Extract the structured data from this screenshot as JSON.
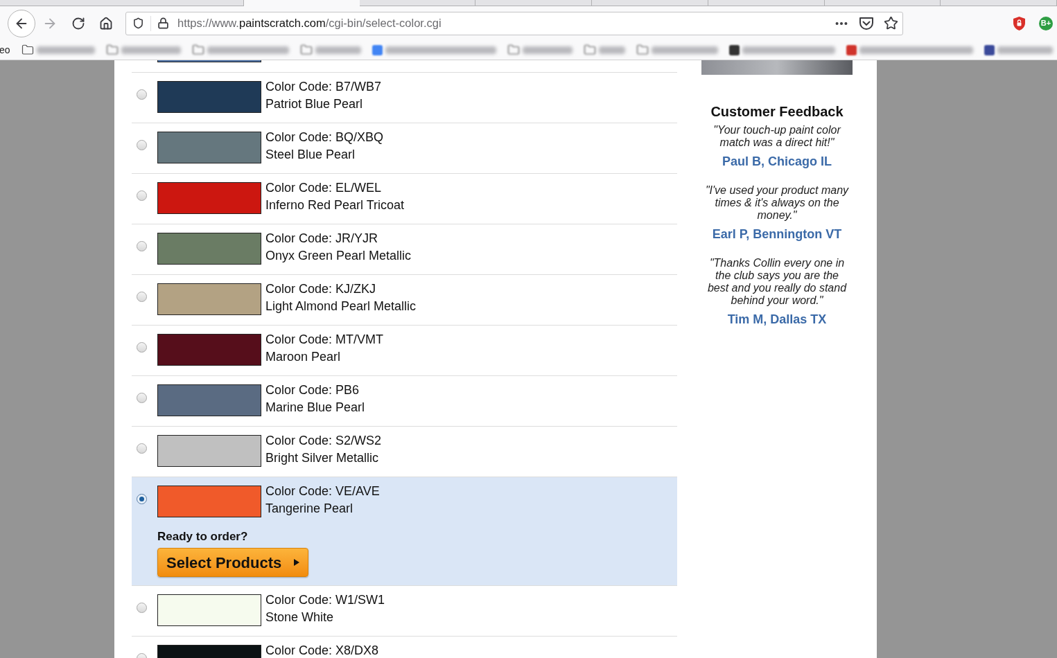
{
  "browser": {
    "tabs": [
      {
        "selected": false
      },
      {
        "selected": true
      },
      {
        "selected": false
      },
      {
        "selected": false
      },
      {
        "selected": false
      },
      {
        "selected": false
      },
      {
        "selected": false
      },
      {
        "selected": false
      }
    ],
    "navigation": {
      "forward_disabled": true
    },
    "address_bar": {
      "url_prefix": "https://www.",
      "url_domain": "paintscratch.com",
      "url_path": "/cgi-bin/select-color.cgi"
    },
    "extension_badge": "B+",
    "bookmarks": {
      "clipped_label": "eo",
      "items": [
        {
          "kind": "folder"
        },
        {
          "kind": "folder"
        },
        {
          "kind": "folder"
        },
        {
          "kind": "folder"
        },
        {
          "kind": "site",
          "color": "#4285f4"
        },
        {
          "kind": "folder"
        },
        {
          "kind": "folder"
        },
        {
          "kind": "folder"
        },
        {
          "kind": "site",
          "color": "#333333"
        },
        {
          "kind": "site",
          "color": "#d0342c"
        },
        {
          "kind": "site",
          "color": "#3b4a9a"
        }
      ]
    }
  },
  "color_list": {
    "clipped_swatch": {
      "color": "#4a6fa5"
    },
    "items": [
      {
        "code": "Color Code: B7/WB7",
        "name": "Patriot Blue Pearl",
        "color": "#1f3a57",
        "selected": false
      },
      {
        "code": "Color Code: BQ/XBQ",
        "name": "Steel Blue Pearl",
        "color": "#65777e",
        "selected": false
      },
      {
        "code": "Color Code: EL/WEL",
        "name": "Inferno Red Pearl Tricoat",
        "color": "#cc1710",
        "selected": false
      },
      {
        "code": "Color Code: JR/YJR",
        "name": "Onyx Green Pearl Metallic",
        "color": "#6a7c64",
        "selected": false
      },
      {
        "code": "Color Code: KJ/ZKJ",
        "name": "Light Almond Pearl Metallic",
        "color": "#b3a283",
        "selected": false
      },
      {
        "code": "Color Code: MT/VMT",
        "name": "Maroon Pearl",
        "color": "#560e1b",
        "selected": false
      },
      {
        "code": "Color Code: PB6",
        "name": "Marine Blue Pearl",
        "color": "#5a6b82",
        "selected": false
      },
      {
        "code": "Color Code: S2/WS2",
        "name": "Bright Silver Metallic",
        "color": "#c0c0c0",
        "selected": false
      },
      {
        "code": "Color Code: VE/AVE",
        "name": "Tangerine Pearl",
        "color": "#f05a2a",
        "selected": true
      },
      {
        "code": "Color Code: W1/SW1",
        "name": "Stone White",
        "color": "#f6fbee",
        "selected": false
      },
      {
        "code": "Color Code: X8/DX8",
        "color": "#0b1214",
        "selected": false
      }
    ]
  },
  "order_panel": {
    "prompt": "Ready to order?",
    "button": "Select Products"
  },
  "sidebar": {
    "title": "Customer Feedback",
    "testimonials": [
      {
        "quote": "\"Your touch-up paint color match was a direct hit!\"",
        "author": "Paul B, Chicago IL"
      },
      {
        "quote": "\"I've used your product many times & it's always on the money.\"",
        "author": "Earl P, Bennington VT"
      },
      {
        "quote": "\"Thanks Collin every one in the club says you are the best and you really do stand behind your word.\"",
        "author": "Tim M, Dallas TX"
      }
    ]
  }
}
